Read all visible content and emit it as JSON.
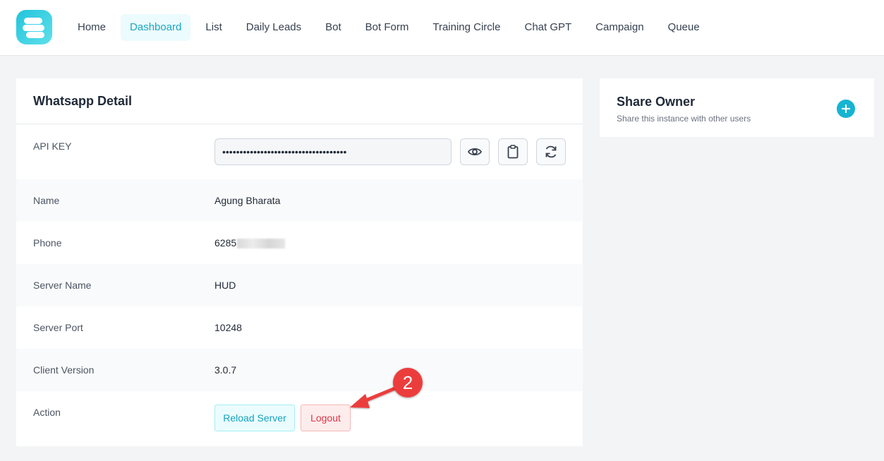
{
  "nav": {
    "items": [
      {
        "label": "Home"
      },
      {
        "label": "Dashboard",
        "active": true
      },
      {
        "label": "List"
      },
      {
        "label": "Daily Leads"
      },
      {
        "label": "Bot"
      },
      {
        "label": "Bot Form"
      },
      {
        "label": "Training Circle"
      },
      {
        "label": "Chat GPT"
      },
      {
        "label": "Campaign"
      },
      {
        "label": "Queue"
      }
    ]
  },
  "whatsapp": {
    "title": "Whatsapp Detail",
    "api_key": {
      "label": "API KEY",
      "masked_value": "••••••••••••••••••••••••••••••••••••",
      "icons": [
        "eye-icon",
        "clipboard-icon",
        "refresh-icon"
      ]
    },
    "name": {
      "label": "Name",
      "value": "Agung Bharata"
    },
    "phone": {
      "label": "Phone",
      "value": "6285"
    },
    "server_name": {
      "label": "Server Name",
      "value": "HUD"
    },
    "server_port": {
      "label": "Server Port",
      "value": "10248"
    },
    "client_version": {
      "label": "Client Version",
      "value": "3.0.7"
    },
    "action": {
      "label": "Action",
      "reload_label": "Reload Server",
      "logout_label": "Logout"
    }
  },
  "share_owner": {
    "title": "Share Owner",
    "subtitle": "Share this instance with other users",
    "add_icon": "plus-icon"
  },
  "annotation": {
    "step_number": "2"
  },
  "colors": {
    "accent": "#16b4d1",
    "danger": "#dc3545",
    "annotation": "#ec3d3d"
  }
}
